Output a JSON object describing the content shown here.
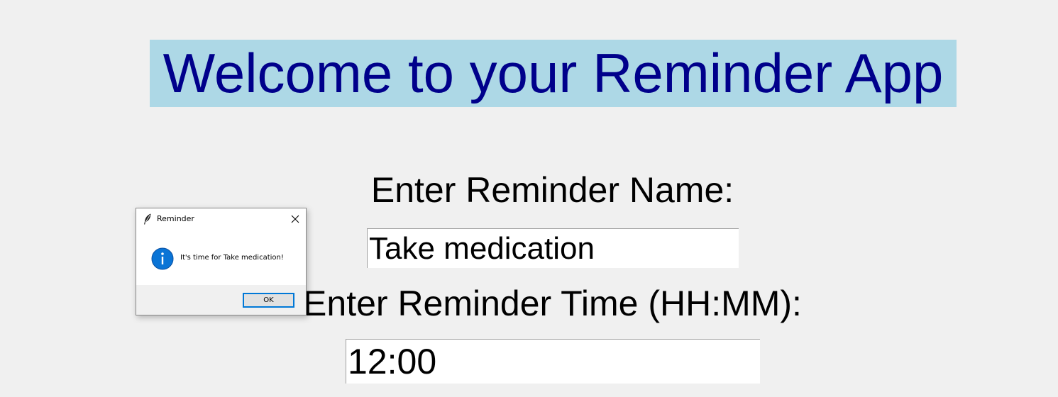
{
  "app": {
    "title": "Welcome to your Reminder App",
    "title_bg": "#add8e6",
    "title_color": "#00008b"
  },
  "form": {
    "name_label": "Enter Reminder Name:",
    "name_value": "Take medication",
    "time_label": "Enter Reminder Time (HH:MM):",
    "time_value": "12:00"
  },
  "dialog": {
    "title": "Reminder",
    "message": "It's time for Take medication!",
    "ok_label": "OK",
    "icon": "info-icon",
    "window_icon": "feather-icon",
    "close_icon": "close-icon",
    "accent": "#0078d7"
  }
}
